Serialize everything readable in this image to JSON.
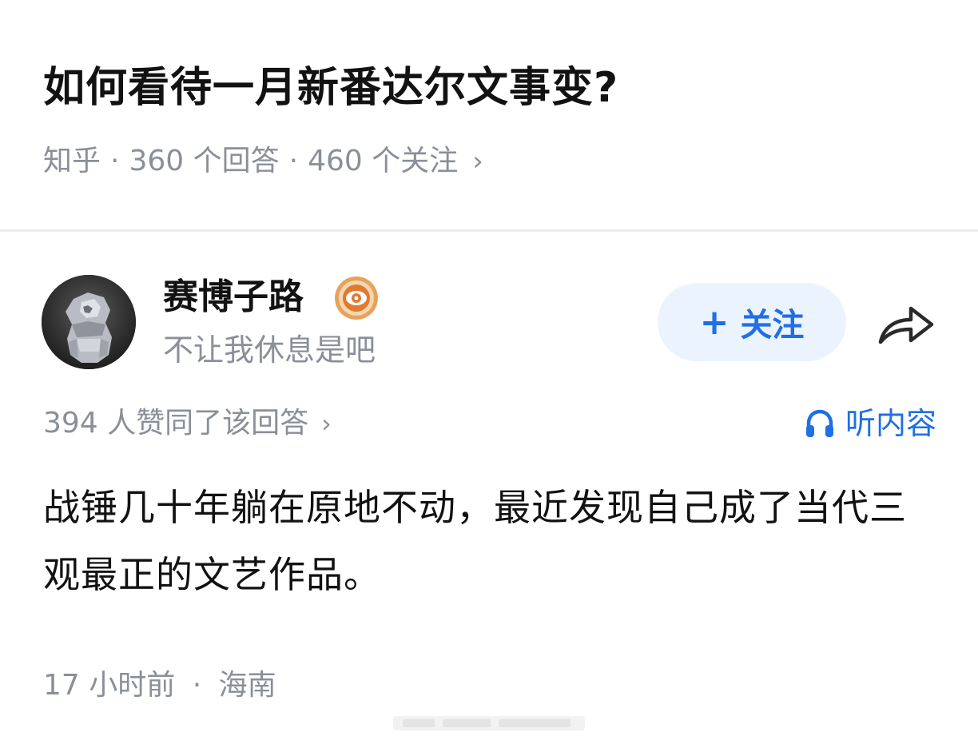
{
  "question": {
    "title": "如何看待一月新番达尔文事变?",
    "source": "知乎",
    "answers_count": "360 个回答",
    "followers_count": "460 个关注"
  },
  "author": {
    "name": "赛博子路",
    "bio": "不让我休息是吧",
    "badge_icon": "achievement-badge-icon",
    "avatar_icon": "avatar-image"
  },
  "actions": {
    "follow_label": "关注",
    "follow_icon": "plus-icon",
    "share_icon": "share-arrow-icon",
    "listen_label": "听内容",
    "listen_icon": "headphones-icon"
  },
  "answer": {
    "likes_text": "394 人赞同了该回答",
    "content": "战锤几十年躺在原地不动，最近发现自己成了当代三观最正的文艺作品。",
    "time": "17 小时前",
    "location": "海南"
  },
  "colors": {
    "accent": "#1f6fe5",
    "follow_bg": "#ebf3fe",
    "meta_gray": "#8a8f99",
    "title": "#121212"
  }
}
